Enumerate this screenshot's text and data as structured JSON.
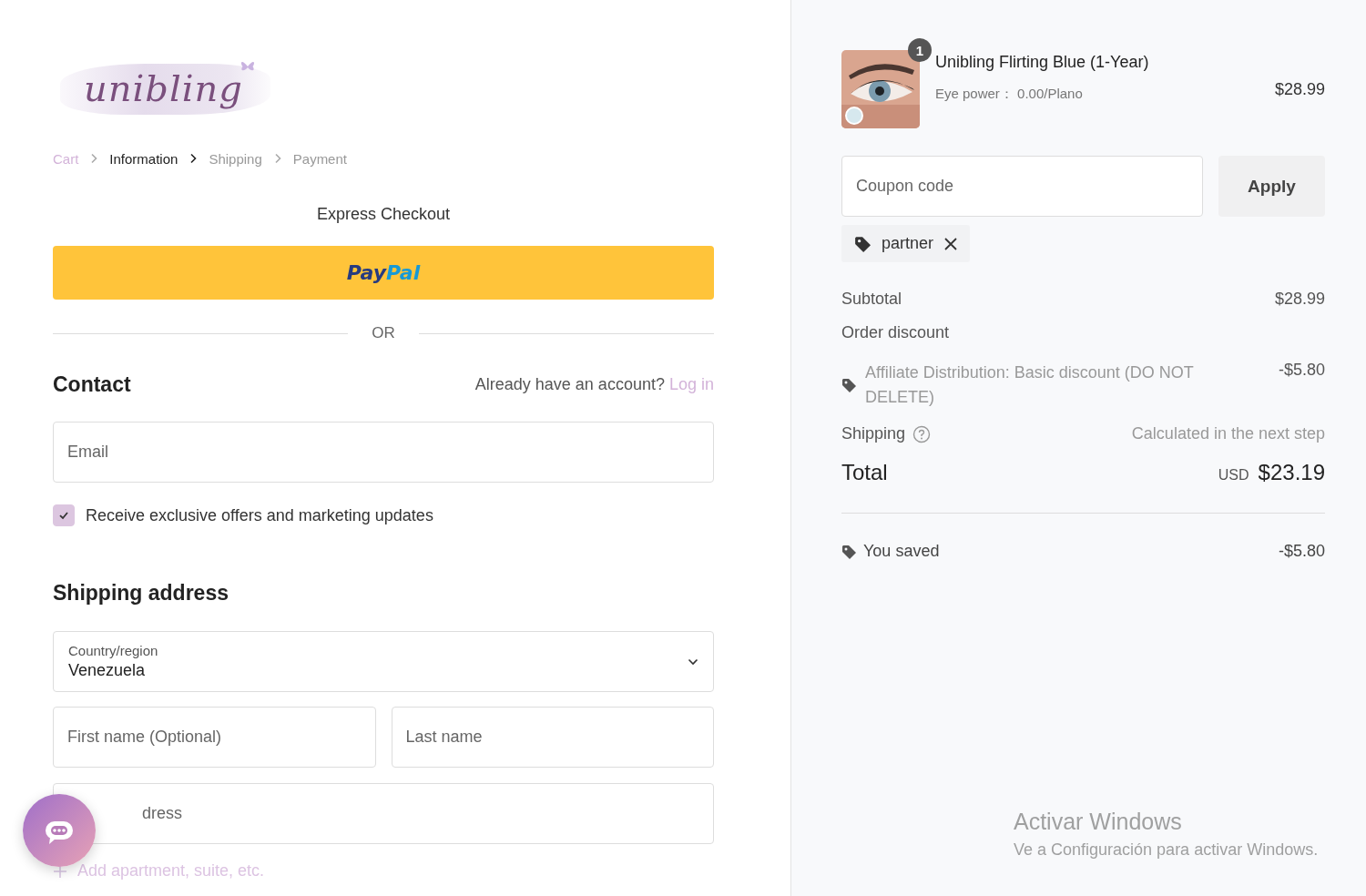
{
  "logo": {
    "text": "unibling"
  },
  "breadcrumb": [
    {
      "label": "Cart",
      "visited": true,
      "selected": false
    },
    {
      "label": "Information",
      "visited": false,
      "selected": true
    },
    {
      "label": "Shipping",
      "visited": false,
      "selected": false
    },
    {
      "label": "Payment",
      "visited": false,
      "selected": false
    }
  ],
  "express_checkout": {
    "title": "Express Checkout",
    "paypal": {
      "pay": "Pay",
      "pal": "Pal"
    },
    "divider": "OR"
  },
  "contact": {
    "title": "Contact",
    "account_prompt": "Already have an account?",
    "login_link": "Log in",
    "email": {
      "placeholder": "Email"
    },
    "marketing": {
      "label": "Receive exclusive offers and marketing updates",
      "checked": true
    }
  },
  "shipping_address": {
    "title": "Shipping address",
    "country": {
      "label": "Country/region",
      "value": "Venezuela"
    },
    "first_name": {
      "placeholder": "First name (Optional)"
    },
    "last_name": {
      "placeholder": "Last name"
    },
    "address": {
      "placeholder": "dress"
    },
    "add_line": "Add apartment, suite, etc."
  },
  "summary": {
    "item": {
      "quantity": "1",
      "name": "Unibling Flirting Blue (1-Year)",
      "variant": "Eye power： 0.00/Plano",
      "price": "$28.99"
    },
    "coupon": {
      "placeholder": "Coupon code",
      "button": "Apply",
      "applied": "partner"
    },
    "subtotal": {
      "label": "Subtotal",
      "value": "$28.99"
    },
    "order_discount": {
      "label": "Order discount",
      "name": "Affiliate Distribution: Basic discount (DO NOT DELETE)",
      "value": "-$5.80"
    },
    "shipping": {
      "label": "Shipping",
      "value": "Calculated in the next step"
    },
    "total": {
      "label": "Total",
      "currency": "USD",
      "value": "$23.19"
    },
    "saved": {
      "label": "You saved",
      "value": "-$5.80"
    }
  },
  "os_watermark": {
    "title": "Activar Windows",
    "subtitle": "Ve a Configuración para activar Windows."
  }
}
